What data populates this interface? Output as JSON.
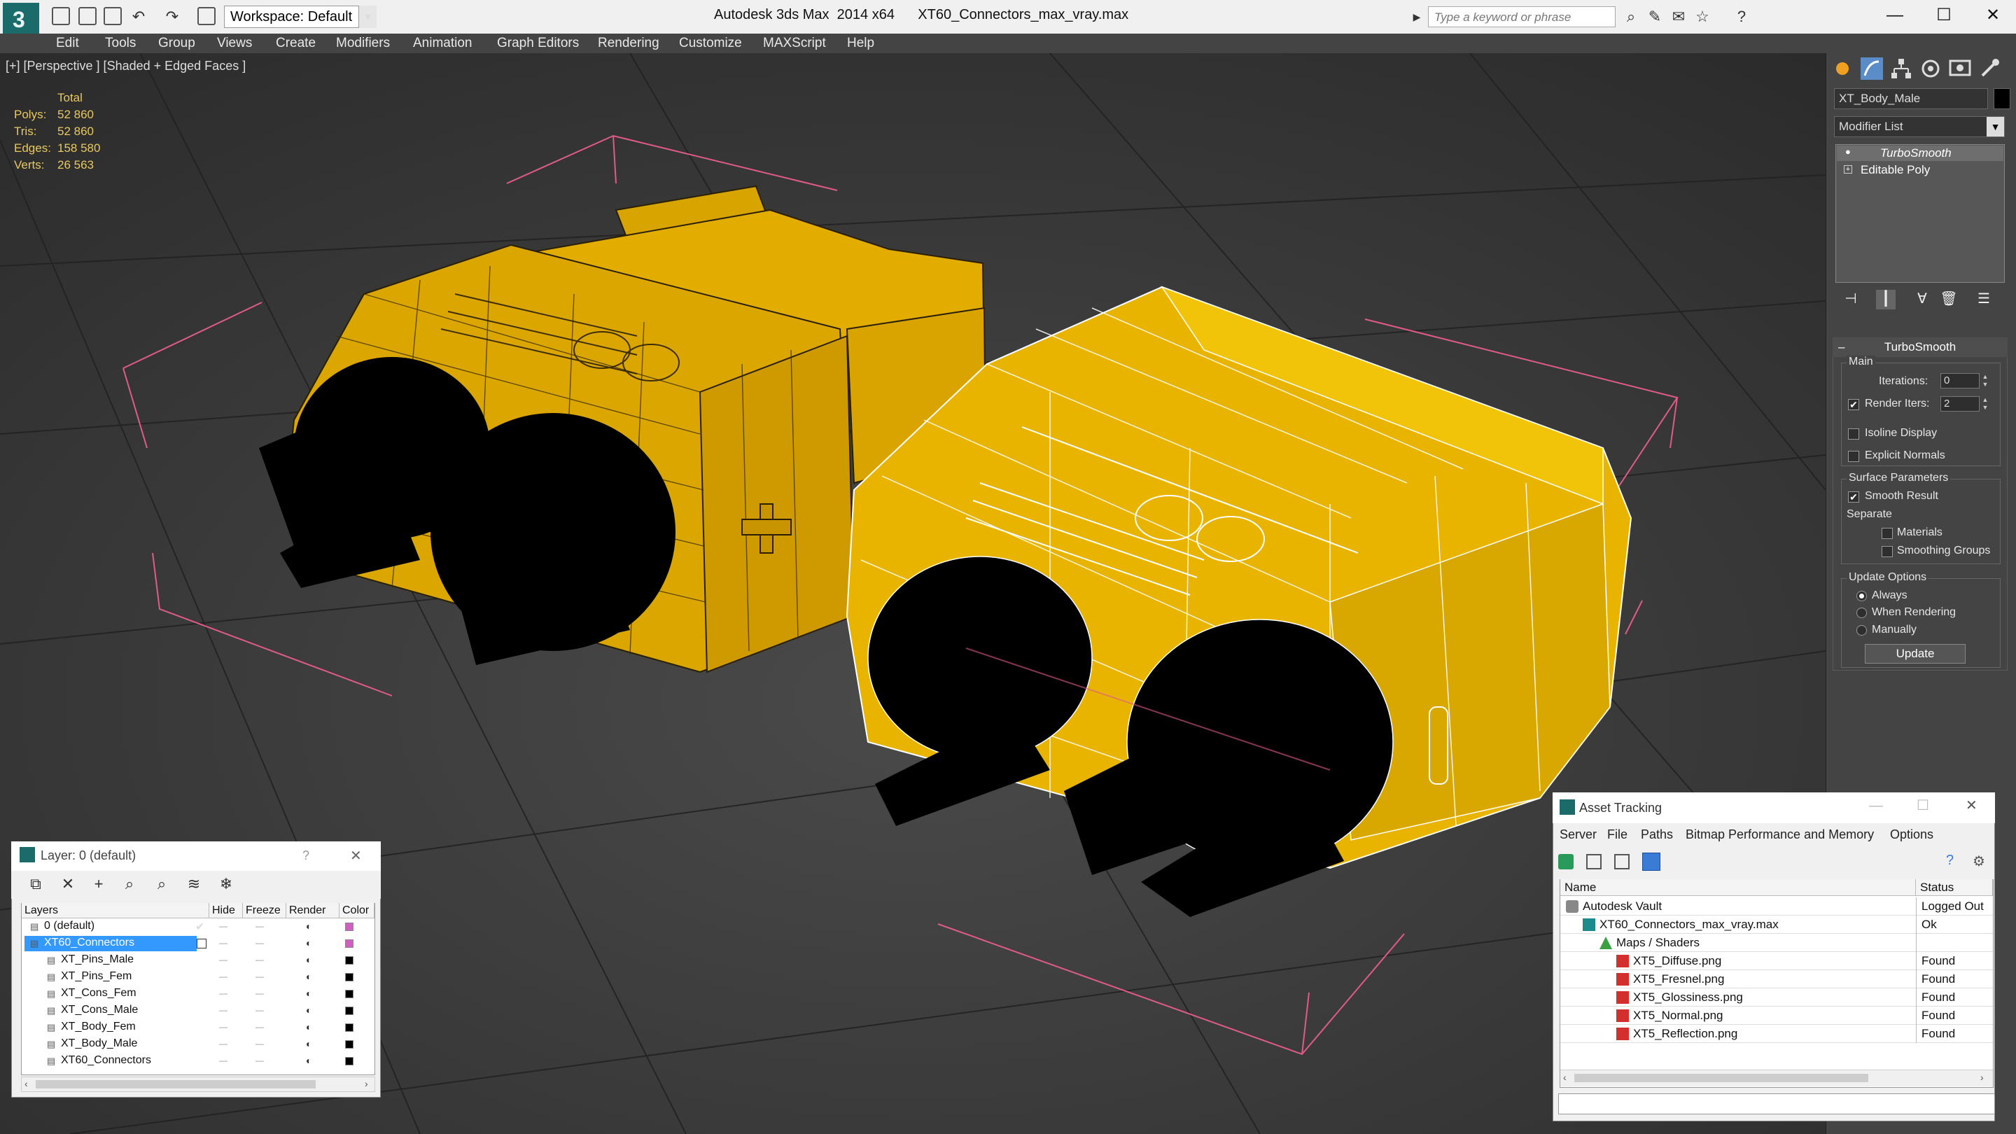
{
  "titlebar": {
    "workspace": "Workspace: Default",
    "app_name": "Autodesk 3ds Max  2014 x64",
    "file_name": "XT60_Connectors_max_vray.max",
    "search_placeholder": "Type a keyword or phrase"
  },
  "menu": [
    "Edit",
    "Tools",
    "Group",
    "Views",
    "Create",
    "Modifiers",
    "Animation",
    "Graph Editors",
    "Rendering",
    "Customize",
    "MAXScript",
    "Help"
  ],
  "viewport": {
    "label": "[+] [Perspective ] [Shaded + Edged Faces ]",
    "stats": {
      "total_label": "Total",
      "rows": [
        {
          "label": "Polys:",
          "value": "52 860"
        },
        {
          "label": "Tris:",
          "value": "52 860"
        },
        {
          "label": "Edges:",
          "value": "158 580"
        },
        {
          "label": "Verts:",
          "value": "26 563"
        }
      ]
    }
  },
  "command_panel": {
    "object_name": "XT_Body_Male",
    "modifier_list": "Modifier List",
    "stack": [
      "TurboSmooth",
      "Editable Poly"
    ],
    "turbosmooth": {
      "title": "TurboSmooth",
      "main_group": "Main",
      "iterations_label": "Iterations:",
      "iterations_value": "0",
      "render_iters_label": "Render Iters:",
      "render_iters_value": "2",
      "render_iters_checked": true,
      "isoline_label": "Isoline Display",
      "explicit_normals_label": "Explicit Normals",
      "surface_params_label": "Surface Parameters",
      "smooth_result_label": "Smooth Result",
      "separate_label": "Separate",
      "materials_label": "Materials",
      "smoothing_groups_label": "Smoothing Groups",
      "update_options_label": "Update Options",
      "always_label": "Always",
      "when_rendering_label": "When Rendering",
      "manually_label": "Manually",
      "update_button": "Update"
    }
  },
  "layer_dialog": {
    "title": "Layer: 0 (default)",
    "help": "?",
    "columns": [
      "Layers",
      "Hide",
      "Freeze",
      "Render",
      "Color"
    ],
    "rows": [
      {
        "name": "0 (default)",
        "indent": 0,
        "color": "#d060c0",
        "selected": false,
        "checked": true
      },
      {
        "name": "XT60_Connectors",
        "indent": 0,
        "color": "#d060c0",
        "selected": true,
        "checked": false
      },
      {
        "name": "XT_Pins_Male",
        "indent": 1,
        "color": "#000000",
        "selected": false,
        "checked": false
      },
      {
        "name": "XT_Pins_Fem",
        "indent": 1,
        "color": "#000000",
        "selected": false,
        "checked": false
      },
      {
        "name": "XT_Cons_Fem",
        "indent": 1,
        "color": "#000000",
        "selected": false,
        "checked": false
      },
      {
        "name": "XT_Cons_Male",
        "indent": 1,
        "color": "#000000",
        "selected": false,
        "checked": false
      },
      {
        "name": "XT_Body_Fem",
        "indent": 1,
        "color": "#000000",
        "selected": false,
        "checked": false
      },
      {
        "name": "XT_Body_Male",
        "indent": 1,
        "color": "#000000",
        "selected": false,
        "checked": false
      },
      {
        "name": "XT60_Connectors",
        "indent": 1,
        "color": "#000000",
        "selected": false,
        "checked": false
      }
    ]
  },
  "asset_dialog": {
    "title": "Asset Tracking",
    "menu": [
      "Server",
      "File",
      "Paths",
      "Bitmap Performance and Memory",
      "Options"
    ],
    "columns": [
      "Name",
      "Status"
    ],
    "rows": [
      {
        "name": "Autodesk Vault",
        "indent": 0,
        "status": "Logged Out",
        "icon": "vault-icon"
      },
      {
        "name": "XT60_Connectors_max_vray.max",
        "indent": 1,
        "status": "Ok",
        "icon": "max-file-icon"
      },
      {
        "name": "Maps / Shaders",
        "indent": 2,
        "status": "",
        "icon": "maps-icon"
      },
      {
        "name": "XT5_Diffuse.png",
        "indent": 3,
        "status": "Found",
        "icon": "png-icon"
      },
      {
        "name": "XT5_Fresnel.png",
        "indent": 3,
        "status": "Found",
        "icon": "png-icon"
      },
      {
        "name": "XT5_Glossiness.png",
        "indent": 3,
        "status": "Found",
        "icon": "png-icon"
      },
      {
        "name": "XT5_Normal.png",
        "indent": 3,
        "status": "Found",
        "icon": "png-icon"
      },
      {
        "name": "XT5_Reflection.png",
        "indent": 3,
        "status": "Found",
        "icon": "png-icon"
      }
    ]
  },
  "colors": {
    "model_yellow": "#e8b400",
    "bbox_pink": "#e05b8a",
    "stats_text": "#e8c860",
    "selection_blue": "#3399ff"
  }
}
